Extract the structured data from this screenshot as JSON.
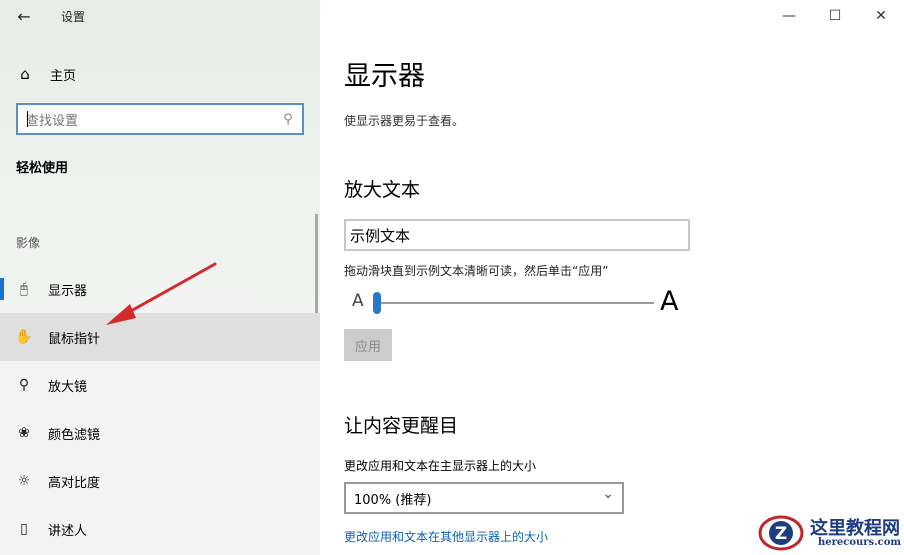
{
  "window": {
    "title": "设置"
  },
  "sidebar": {
    "home_label": "主页",
    "search_placeholder": "查找设置",
    "section_title": "轻松使用",
    "group_label": "影像",
    "items": [
      {
        "label": "显示器",
        "icon": "monitor-icon",
        "active": true
      },
      {
        "label": "鼠标指针",
        "icon": "mouse-pointer-icon",
        "hover": true
      },
      {
        "label": "放大镜",
        "icon": "magnifier-icon"
      },
      {
        "label": "颜色滤镜",
        "icon": "color-filter-icon"
      },
      {
        "label": "高对比度",
        "icon": "high-contrast-icon"
      },
      {
        "label": "讲述人",
        "icon": "narrator-icon"
      }
    ]
  },
  "content": {
    "title": "显示器",
    "description": "使显示器更易于查看。",
    "enlarge_text": {
      "heading": "放大文本",
      "sample_text": "示例文本",
      "hint": "拖动滑块直到示例文本清晰可读，然后单击“应用”",
      "small_a": "A",
      "large_a": "A",
      "slider_value": 0,
      "apply_label": "应用"
    },
    "make_everything_bigger": {
      "heading": "让内容更醒目",
      "size_label": "更改应用和文本在主显示器上的大小",
      "selected_option": "100% (推荐)",
      "link": "更改应用和文本在其他显示器上的大小"
    }
  },
  "watermark": {
    "name": "这里教程网",
    "url": "herecours.com"
  },
  "colors": {
    "accent": "#1a73d1",
    "link": "#0b62b8",
    "arrow": "#d42a2a"
  }
}
